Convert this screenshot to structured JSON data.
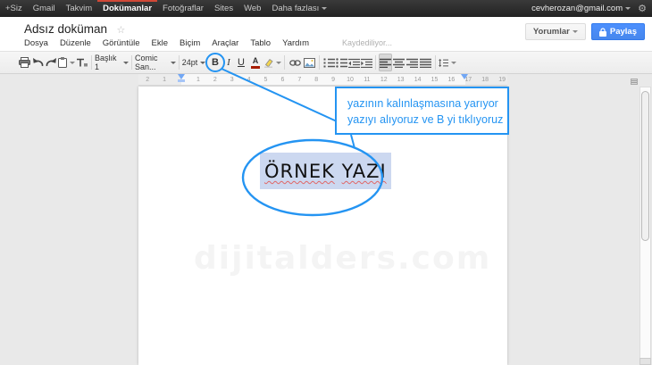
{
  "topbar": {
    "links": [
      "+Siz",
      "Gmail",
      "Takvim",
      "Dokümanlar",
      "Fotoğraflar",
      "Sites",
      "Web",
      "Daha fazlası"
    ],
    "active_link": "Dokümanlar",
    "email": "cevherozan@gmail.com",
    "gear_icon": "⚙",
    "dropdown_arrow": "▾"
  },
  "header": {
    "title": "Adsız doküman",
    "star_icon": "☆",
    "menus": [
      "Dosya",
      "Düzenle",
      "Görüntüle",
      "Ekle",
      "Biçim",
      "Araçlar",
      "Tablo",
      "Yardım"
    ],
    "saving_status": "Kaydediliyor...",
    "comments_button": "Yorumlar",
    "share_button": "Paylaş"
  },
  "toolbar": {
    "style_dropdown": "Başlık 1",
    "font_dropdown": "Comic San...",
    "size_dropdown": "24pt",
    "bold_label": "B",
    "italic_label": "I",
    "underline_label": "U",
    "text_color_label": "A"
  },
  "ruler": {
    "left_numbers": [
      2,
      1
    ],
    "numbers": [
      1,
      2,
      3,
      4,
      5,
      6,
      7,
      8,
      9,
      10,
      11,
      12,
      13,
      14,
      15,
      16,
      17,
      18,
      19
    ]
  },
  "page": {
    "words": [
      "ÖRNEK",
      "YAZI"
    ],
    "watermark": "dijitalders.com"
  },
  "callout": {
    "line1": "yazının kalınlaşmasına yarıyor",
    "line2": "yazıyı alıyoruz ve B yi tıklıyoruz"
  },
  "colors": {
    "annotation_blue": "#2494f2",
    "share_button_blue": "#4d90fe",
    "topbar_active_red": "#d14836",
    "selection_highlight": "#ccd8f0",
    "spellcheck_red": "#e06666"
  }
}
